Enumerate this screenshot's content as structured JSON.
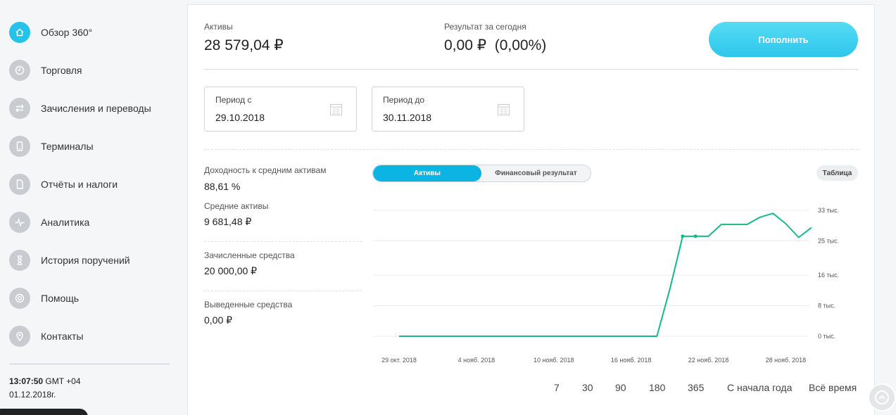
{
  "colors": {
    "accent": "#27c2ea",
    "line": "#14b98a",
    "segment_active": "#0cb4e4"
  },
  "sidebar": {
    "items": [
      {
        "label": "Обзор 360°",
        "icon": "home-icon",
        "active": true
      },
      {
        "label": "Торговля",
        "icon": "clock-icon"
      },
      {
        "label": "Зачисления и переводы",
        "icon": "transfer-arrows-icon"
      },
      {
        "label": "Терминалы",
        "icon": "device-icon"
      },
      {
        "label": "Отчёты и налоги",
        "icon": "document-icon"
      },
      {
        "label": "Аналитика",
        "icon": "pulse-icon"
      },
      {
        "label": "История поручений",
        "icon": "hourglass-icon"
      },
      {
        "label": "Помощь",
        "icon": "lifebuoy-icon"
      },
      {
        "label": "Контакты",
        "icon": "location-pin-icon"
      }
    ],
    "clock": {
      "time": "13:07:50",
      "zone": "GMT +04",
      "date": "01.12.2018г."
    }
  },
  "summary": {
    "assets_label": "Активы",
    "assets_value": "28 579,04 ₽",
    "today_label": "Результат за сегодня",
    "today_value": "0,00 ₽  (0,00%)",
    "topup_label": "Пополнить"
  },
  "period": {
    "from_label": "Период с",
    "from_value": "29.10.2018",
    "to_label": "Период до",
    "to_value": "30.11.2018"
  },
  "stats": {
    "yield_label": "Доходность к средним активам",
    "yield_value": "88,61 %",
    "avg_label": "Средние активы",
    "avg_value": "9 681,48 ₽",
    "in_label": "Зачисленные средства",
    "in_value": "20 000,00 ₽",
    "out_label": "Выведенные средства",
    "out_value": "0,00 ₽"
  },
  "tabs": {
    "active": "Активы",
    "other": "Финансовый результат",
    "table": "Таблица"
  },
  "chart_data": {
    "type": "line",
    "title": "",
    "x_tick_labels": [
      "29 окт. 2018",
      "4 нояб. 2018",
      "10 нояб. 2018",
      "16 нояб. 2018",
      "22 нояб. 2018",
      "28 нояб. 2018"
    ],
    "y_tick_labels": [
      "33 тыс.",
      "25 тыс.",
      "16 тыс.",
      "8 тыс.",
      "0 тыс."
    ],
    "y_tick_values": [
      33000,
      25000,
      16000,
      8000,
      0
    ],
    "ylim": [
      0,
      33000
    ],
    "grid": true,
    "series": [
      {
        "x": [
          "2018-10-29",
          "2018-10-30",
          "2018-10-31",
          "2018-11-01",
          "2018-11-02",
          "2018-11-03",
          "2018-11-04",
          "2018-11-05",
          "2018-11-06",
          "2018-11-07",
          "2018-11-08",
          "2018-11-09",
          "2018-11-10",
          "2018-11-11",
          "2018-11-12",
          "2018-11-13",
          "2018-11-14",
          "2018-11-15",
          "2018-11-16",
          "2018-11-17",
          "2018-11-18",
          "2018-11-19",
          "2018-11-20",
          "2018-11-21",
          "2018-11-22",
          "2018-11-23",
          "2018-11-24",
          "2018-11-25",
          "2018-11-26",
          "2018-11-27",
          "2018-11-28",
          "2018-11-29",
          "2018-11-30"
        ],
        "values": [
          0,
          0,
          0,
          0,
          0,
          0,
          0,
          0,
          0,
          0,
          0,
          0,
          0,
          0,
          0,
          0,
          0,
          0,
          0,
          0,
          0,
          12300,
          26200,
          26200,
          26200,
          29300,
          29300,
          29300,
          31200,
          32200,
          29500,
          25900,
          28500
        ],
        "markers": [
          "2018-11-20",
          "2018-11-21"
        ]
      }
    ],
    "range_buttons": [
      "7",
      "30",
      "90",
      "180",
      "365",
      "С начала года",
      "Всё время"
    ]
  }
}
